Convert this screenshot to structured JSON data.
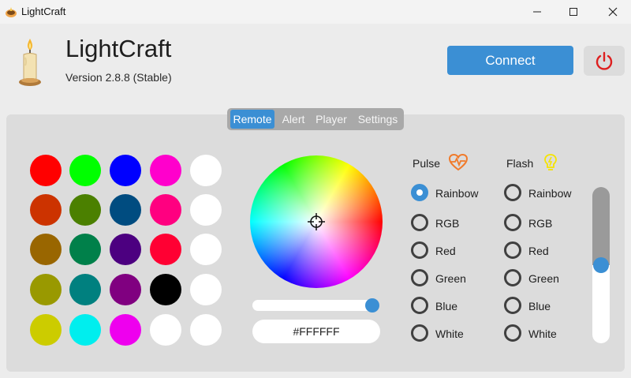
{
  "window": {
    "title": "LightCraft",
    "controls": [
      "minimize",
      "maximize",
      "close"
    ]
  },
  "header": {
    "app_name": "LightCraft",
    "version": "Version 2.8.8 (Stable)",
    "connect_label": "Connect",
    "power_icon": "power-icon"
  },
  "tabs": [
    {
      "label": "Remote",
      "active": true
    },
    {
      "label": "Alert",
      "active": false
    },
    {
      "label": "Player",
      "active": false
    },
    {
      "label": "Settings",
      "active": false
    }
  ],
  "swatches": [
    [
      "#ff0000",
      "#00ff00",
      "#0000ff",
      "#ff00cc",
      "#ffffff"
    ],
    [
      "#cc3300",
      "#4b8000",
      "#004c80",
      "#ff0080",
      "#ffffff"
    ],
    [
      "#996600",
      "#00804a",
      "#4c0080",
      "#ff0033",
      "#ffffff"
    ],
    [
      "#999900",
      "#00807f",
      "#800080",
      "#000000",
      "#ffffff"
    ],
    [
      "#cccc00",
      "#00eeee",
      "#ee00ee",
      "#ffffff",
      "#ffffff"
    ]
  ],
  "color_picker": {
    "hex_value": "#FFFFFF",
    "brightness": 1.0
  },
  "pulse": {
    "title": "Pulse",
    "icon": "heart-pulse-icon",
    "options": [
      "Rainbow",
      "RGB",
      "Red",
      "Green",
      "Blue",
      "White"
    ],
    "selected": "Rainbow"
  },
  "flash": {
    "title": "Flash",
    "icon": "lightbulb-icon",
    "options": [
      "Rainbow",
      "RGB",
      "Red",
      "Green",
      "Blue",
      "White"
    ],
    "selected": null
  },
  "speed_slider": {
    "value": 0.5
  },
  "colors": {
    "accent": "#3b8fd4",
    "pulse_icon": "#f07a2a",
    "flash_icon": "#f5e400",
    "power_icon": "#dd1f1f"
  }
}
